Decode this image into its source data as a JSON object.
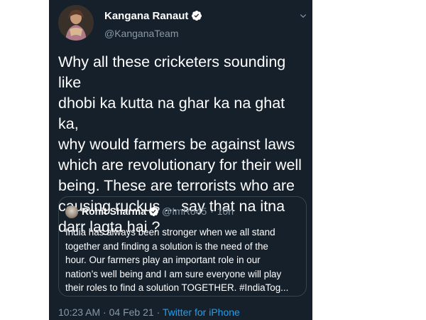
{
  "author": {
    "name": "Kangana Ranaut",
    "handle": "@KanganaTeam",
    "verified": true
  },
  "tweet": {
    "text": "Why all these cricketers sounding like\ndhobi ka kutta na ghar ka na ghat ka,\nwhy would farmers be against laws\nwhich are revolutionary for their well\nbeing. These are terrorists who are\ncausing ruckus ... say that na itna\ndarr lagta hai ?"
  },
  "quoted": {
    "name": "Rohit Sharma",
    "handle": "@ImRo45",
    "separator": "·",
    "time": "10h",
    "verified": true,
    "text": "India has always been stronger when we all stand\ntogether and finding a solution is the need of the\nhour. Our farmers play an important role in our\nnation’s well being and I am sure everyone will play\ntheir roles to find a solution TOGETHER. #IndiaTog..."
  },
  "footer": {
    "time": "10:23 AM",
    "separator": "·",
    "date": "04 Feb 21",
    "separator2": "·",
    "source": "Twitter for iPhone"
  },
  "colors": {
    "background": "#15202b",
    "text": "#ffffff",
    "secondary_text": "#8899a6",
    "link": "#1da1f2",
    "border": "#38444d"
  },
  "icons": {
    "verified": "verified-badge-icon",
    "caret": "chevron-down-icon"
  }
}
